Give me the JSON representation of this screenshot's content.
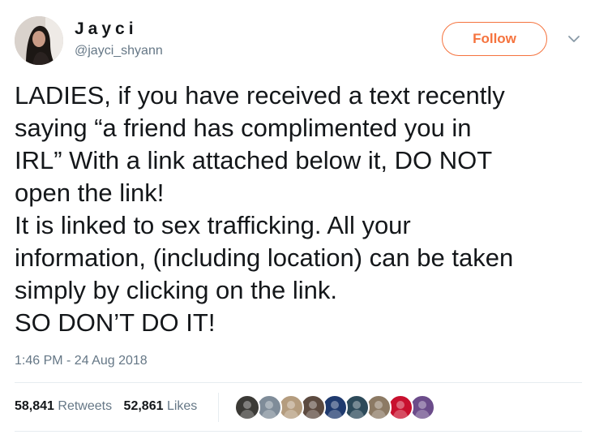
{
  "author": {
    "name": "Jayci",
    "handle": "@jayci_shyann",
    "avatar_icon": "profile-photo"
  },
  "follow_label": "Follow",
  "menu_icon": "chevron-down-icon",
  "tweet": {
    "text": "LADIES, if you have received a text recently\nsaying “a friend has complimented you in\nIRL” With a link attached below it, DO NOT\nopen the link!\nIt is linked to sex trafficking. All your\ninformation, (including location) can be taken\nsimply by clicking on the link.\nSO DON’T DO IT!",
    "timestamp": "1:46 PM - 24 Aug 2018"
  },
  "stats": {
    "retweets_count": "58,841",
    "retweets_label": "Retweets",
    "likes_count": "52,861",
    "likes_label": "Likes"
  },
  "likers": [
    {
      "icon": "liker-avatar-1",
      "color": "#3b3a36"
    },
    {
      "icon": "liker-avatar-2",
      "color": "#7f8c99"
    },
    {
      "icon": "liker-avatar-3",
      "color": "#b49c7e"
    },
    {
      "icon": "liker-avatar-4",
      "color": "#5c4a3f"
    },
    {
      "icon": "liker-avatar-5",
      "color": "#1f3a6e"
    },
    {
      "icon": "liker-avatar-6",
      "color": "#2d4a5a"
    },
    {
      "icon": "liker-avatar-7",
      "color": "#8c7a64"
    },
    {
      "icon": "liker-avatar-8",
      "color": "#c8102e"
    },
    {
      "icon": "liker-avatar-9",
      "color": "#6b4c8a"
    }
  ],
  "colors": {
    "accent": "#f5733e",
    "text": "#14171a",
    "secondary": "#657786",
    "divider": "#e6ecf0"
  }
}
